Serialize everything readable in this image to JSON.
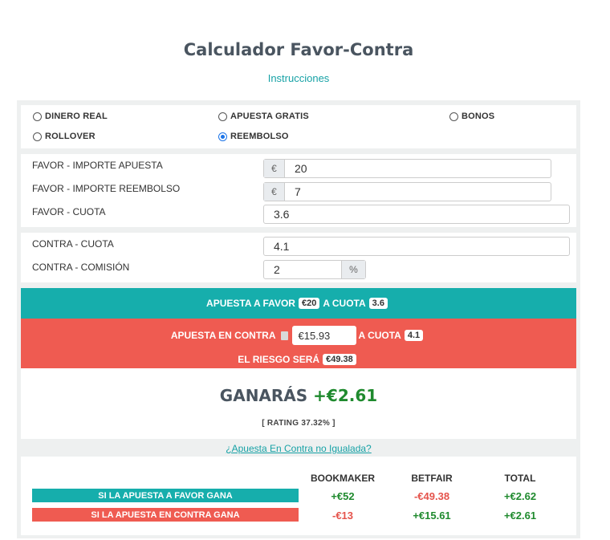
{
  "header": {
    "title": "Calculador Favor-Contra",
    "instructions_link": "Instrucciones"
  },
  "bet_types": [
    {
      "label": "DINERO REAL",
      "checked": false
    },
    {
      "label": "APUESTA GRATIS",
      "checked": false
    },
    {
      "label": "BONOS",
      "checked": false
    },
    {
      "label": "ROLLOVER",
      "checked": false
    },
    {
      "label": "REEMBOLSO",
      "checked": true
    }
  ],
  "favor": {
    "stake_label": "FAVOR - IMPORTE APUESTA",
    "stake_currency": "€",
    "stake_value": "20",
    "refund_label": "FAVOR - IMPORTE REEMBOLSO",
    "refund_currency": "€",
    "refund_value": "7",
    "odds_label": "FAVOR - CUOTA",
    "odds_value": "3.6"
  },
  "contra": {
    "odds_label": "CONTRA - CUOTA",
    "odds_value": "4.1",
    "commission_label": "CONTRA - COMISIÓN",
    "commission_value": "2",
    "commission_unit": "%"
  },
  "summary": {
    "favor_prefix": "APUESTA A FAVOR",
    "favor_stake": "€20",
    "favor_mid": "A CUOTA",
    "favor_odds": "3.6",
    "contra_prefix": "APUESTA EN CONTRA",
    "contra_stake": "€15.93",
    "contra_mid": "A CUOTA",
    "contra_odds": "4.1",
    "risk_label": "EL RIESGO SERÁ",
    "risk_value": "€49.38"
  },
  "result": {
    "label": "GANARÁS",
    "value": "+€2.61",
    "rating": "[ RATING 37.32% ]"
  },
  "unmatched_link": "¿Apuesta En Contra no Igualada?",
  "table": {
    "headers": [
      "BOOKMAKER",
      "BETFAIR",
      "TOTAL"
    ],
    "rows": [
      {
        "label": "SI LA APUESTA A FAVOR GANA",
        "color": "#16aeac",
        "bookmaker": "+€52",
        "betfair": "-€49.38",
        "total": "+€2.62"
      },
      {
        "label": "SI LA APUESTA EN CONTRA GANA",
        "color": "#ef5b51",
        "bookmaker": "-€13",
        "betfair": "+€15.61",
        "total": "+€2.61"
      }
    ]
  },
  "colors": {
    "teal": "#16aeac",
    "red": "#ef5b51",
    "positive": "#1f8a2e",
    "negative": "#e5534b",
    "link": "#17a2a6"
  }
}
